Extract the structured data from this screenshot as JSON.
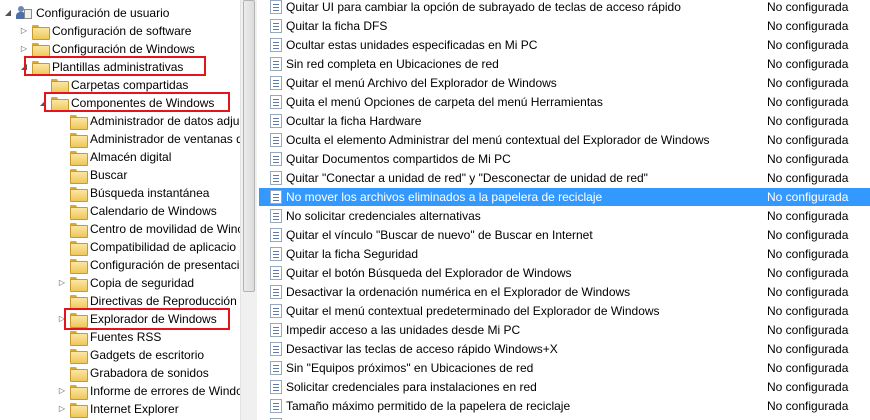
{
  "tree": {
    "root": {
      "label": "Configuración de usuario",
      "icon": "user-config-icon"
    },
    "items": [
      {
        "label": "Configuración de software",
        "expander": "collapsed"
      },
      {
        "label": "Configuración de Windows",
        "expander": "collapsed"
      },
      {
        "label": "Plantillas administrativas",
        "expander": "expanded",
        "highlighted": true
      },
      {
        "label": "Carpetas compartidas",
        "expander": "none"
      },
      {
        "label": "Componentes de Windows",
        "expander": "expanded",
        "highlighted": true
      },
      {
        "label": "Administrador de datos adju",
        "expander": "none"
      },
      {
        "label": "Administrador de ventanas d",
        "expander": "none"
      },
      {
        "label": "Almacén digital",
        "expander": "none"
      },
      {
        "label": "Buscar",
        "expander": "none"
      },
      {
        "label": "Búsqueda instantánea",
        "expander": "none"
      },
      {
        "label": "Calendario de Windows",
        "expander": "none"
      },
      {
        "label": "Centro de movilidad de Winc",
        "expander": "none"
      },
      {
        "label": "Compatibilidad de aplicacio",
        "expander": "none"
      },
      {
        "label": "Configuración de presentaci",
        "expander": "none"
      },
      {
        "label": "Copia de seguridad",
        "expander": "collapsed"
      },
      {
        "label": "Directivas de Reproducción",
        "expander": "none"
      },
      {
        "label": "Explorador de Windows",
        "expander": "collapsed",
        "highlighted": true
      },
      {
        "label": "Fuentes RSS",
        "expander": "none"
      },
      {
        "label": "Gadgets de escritorio",
        "expander": "none"
      },
      {
        "label": "Grabadora de sonidos",
        "expander": "none"
      },
      {
        "label": "Informe de errores de Windo",
        "expander": "collapsed"
      },
      {
        "label": "Internet Explorer",
        "expander": "collapsed"
      }
    ]
  },
  "settings": [
    {
      "name": "Quitar UI para cambiar la opción de subrayado de teclas de acceso rápido",
      "state": "No configurada"
    },
    {
      "name": "Quitar la ficha DFS",
      "state": "No configurada"
    },
    {
      "name": "Ocultar estas unidades especificadas en Mi PC",
      "state": "No configurada"
    },
    {
      "name": "Sin red completa en Ubicaciones de red",
      "state": "No configurada"
    },
    {
      "name": "Quitar el menú Archivo del Explorador de Windows",
      "state": "No configurada"
    },
    {
      "name": "Quita el menú Opciones de carpeta del menú Herramientas",
      "state": "No configurada"
    },
    {
      "name": "Ocultar la ficha Hardware",
      "state": "No configurada"
    },
    {
      "name": "Oculta el elemento Administrar del menú contextual del Explorador de Windows",
      "state": "No configurada"
    },
    {
      "name": "Quitar Documentos compartidos de Mi PC",
      "state": "No configurada"
    },
    {
      "name": "Quitar \"Conectar a unidad de red\" y \"Desconectar de unidad de red\"",
      "state": "No configurada"
    },
    {
      "name": "No mover los archivos eliminados a la papelera de reciclaje",
      "state": "No configurada",
      "selected": true
    },
    {
      "name": "No solicitar credenciales alternativas",
      "state": "No configurada"
    },
    {
      "name": "Quitar el vínculo \"Buscar de nuevo\" de Buscar en Internet",
      "state": "No configurada"
    },
    {
      "name": "Quitar la ficha Seguridad",
      "state": "No configurada"
    },
    {
      "name": "Quitar el botón Búsqueda del Explorador de Windows",
      "state": "No configurada"
    },
    {
      "name": "Desactivar la ordenación numérica en el Explorador de Windows",
      "state": "No configurada"
    },
    {
      "name": "Quitar el menú contextual predeterminado del Explorador de Windows",
      "state": "No configurada"
    },
    {
      "name": "Impedir acceso a las unidades desde Mi PC",
      "state": "No configurada"
    },
    {
      "name": "Desactivar las teclas de acceso rápido Windows+X",
      "state": "No configurada"
    },
    {
      "name": "Sin \"Equipos próximos\" en Ubicaciones de red",
      "state": "No configurada"
    },
    {
      "name": "Solicitar credenciales para instalaciones en red",
      "state": "No configurada"
    },
    {
      "name": "Tamaño máximo permitido de la papelera de reciclaje",
      "state": "No configurada"
    },
    {
      "name": "",
      "state": ""
    }
  ],
  "colors": {
    "selection": "#3399ff",
    "highlight_box": "#e3141b"
  }
}
